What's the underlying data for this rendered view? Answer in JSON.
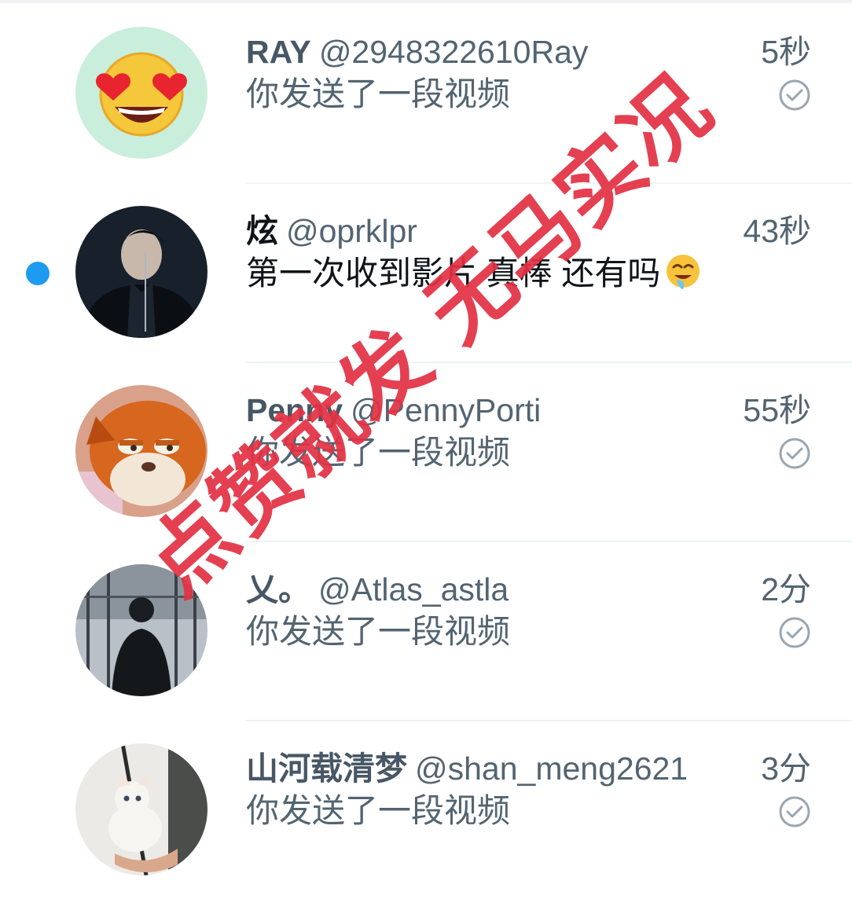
{
  "conversations": [
    {
      "name": "RAY",
      "handle": "@2948322610Ray",
      "time": "5秒",
      "preview": "你发送了一段视频",
      "unread": false,
      "avatar": "heart-eyes-emoji-avatar"
    },
    {
      "name": "炫",
      "handle": "@oprklpr",
      "time": "43秒",
      "preview": "第一次收到影片 真棒  还有吗",
      "preview_emoji": "drooling-face-icon",
      "unread": true,
      "avatar": "dark-portrait-avatar"
    },
    {
      "name": "Penny",
      "handle": "@PennyPorti",
      "time": "55秒",
      "preview": "你发送了一段视频",
      "unread": false,
      "avatar": "fox-plush-avatar"
    },
    {
      "name": "乂。",
      "handle": "@Atlas_astla",
      "time": "2分",
      "preview": "你发送了一段视频",
      "unread": false,
      "avatar": "silhouette-photo-avatar"
    },
    {
      "name": "山河载清梦",
      "handle": "@shan_meng2621",
      "time": "3分",
      "preview": "你发送了一段视频",
      "unread": false,
      "avatar": "white-kitten-avatar"
    }
  ],
  "watermark": "点赞就发 无马实况",
  "colors": {
    "unread_dot": "#1d9bf0",
    "watermark": "#e23244",
    "text_secondary": "#536471"
  }
}
